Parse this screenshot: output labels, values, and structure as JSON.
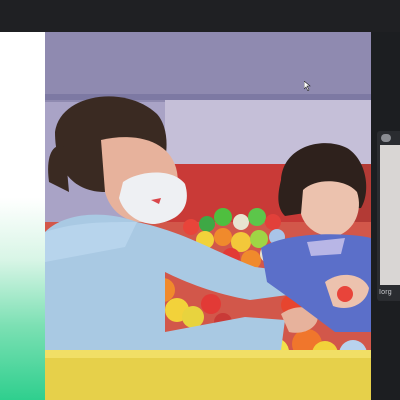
{
  "app": {
    "cursor_icon": "arrow-cursor-icon"
  },
  "thumbnail": {
    "name": "Iorg",
    "mic_icon": "mic-icon",
    "signal_icon": "signal-bars-icon"
  },
  "colors": {
    "top_bar": "#1f2023",
    "panel_green": "#2fcf8e",
    "wall": "#a7a2c4",
    "shirt": "#a9c9e3",
    "pit_yellow": "#e9d24a"
  }
}
